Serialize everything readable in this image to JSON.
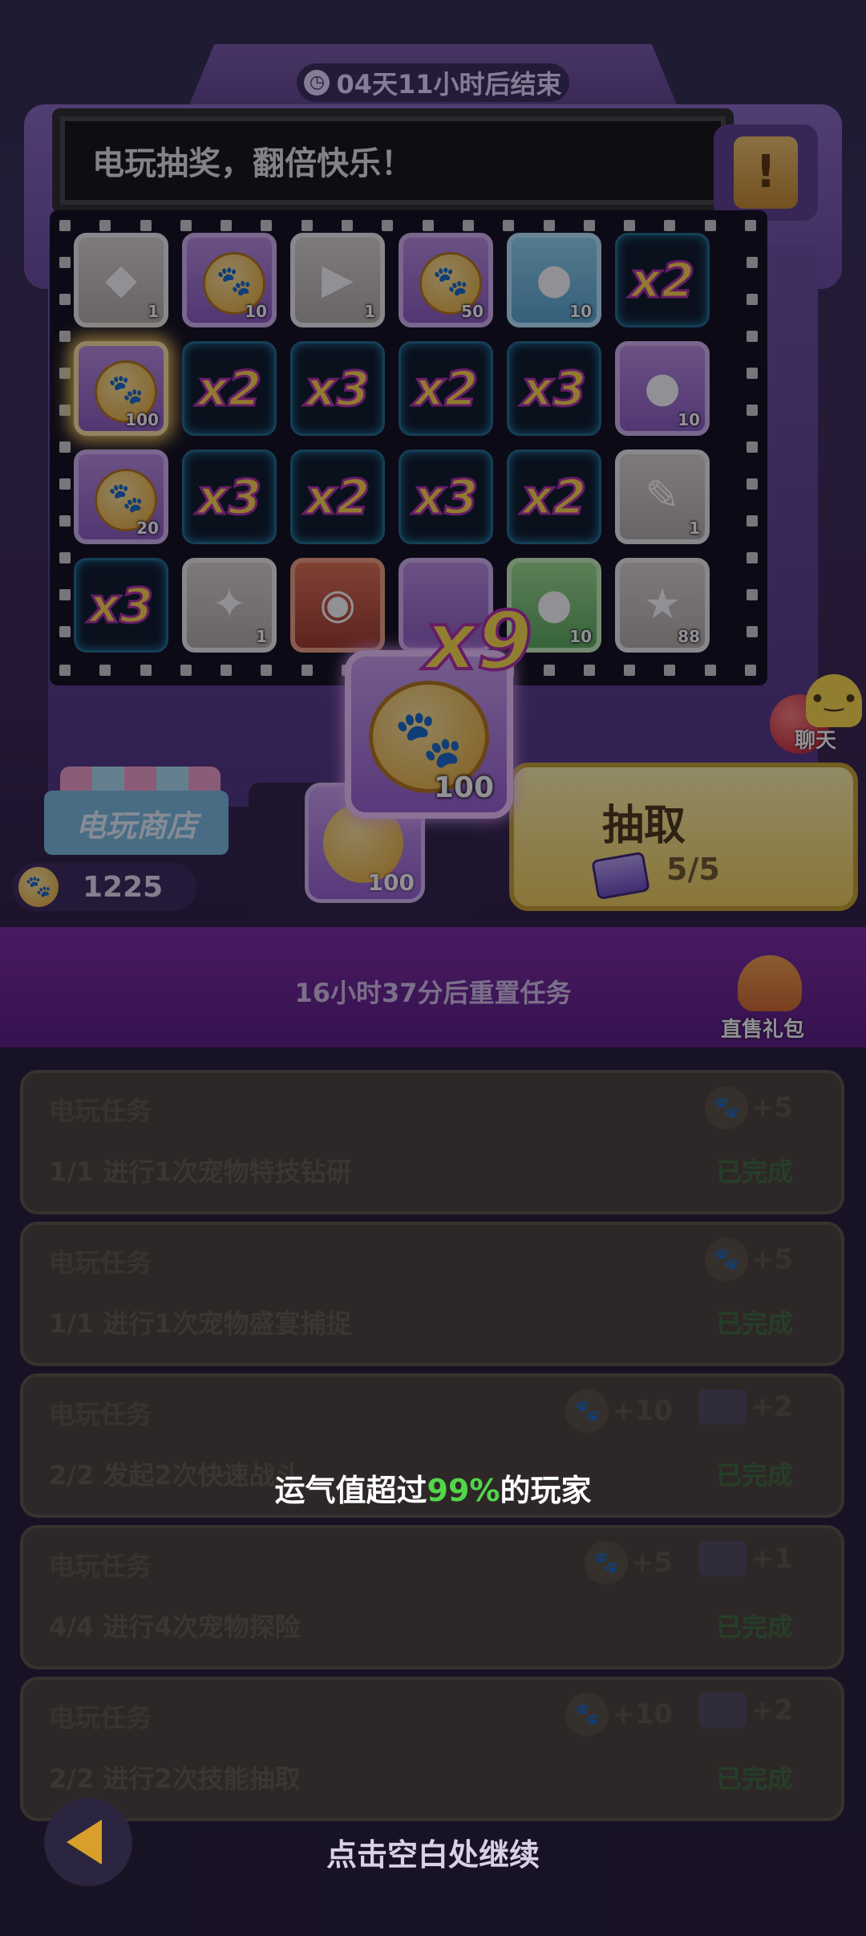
{
  "event": {
    "countdown": "04天11小时后结束",
    "marquee_text": "电玩抽奖，翻倍快乐！",
    "rules_icon": "scroll-exclamation-icon"
  },
  "board": {
    "rows": [
      [
        {
          "kind": "item",
          "tint": "gray",
          "icon": "blue-crystal-icon",
          "count": "1"
        },
        {
          "kind": "item",
          "tint": "purple",
          "icon": "paw-coin-icon",
          "count": "10"
        },
        {
          "kind": "item",
          "tint": "gray",
          "icon": "play-ticket-icon",
          "count": "1"
        },
        {
          "kind": "item",
          "tint": "purple",
          "icon": "paw-coin-icon",
          "count": "50"
        },
        {
          "kind": "item",
          "tint": "blue",
          "icon": "blue-slime-icon",
          "count": "10"
        },
        {
          "kind": "mult",
          "label": "x2"
        }
      ],
      [
        {
          "kind": "item",
          "tint": "purple",
          "icon": "paw-coin-icon",
          "count": "100",
          "lit": true
        },
        {
          "kind": "mult",
          "label": "x2"
        },
        {
          "kind": "mult",
          "label": "x3"
        },
        {
          "kind": "mult",
          "label": "x2"
        },
        {
          "kind": "mult",
          "label": "x3"
        },
        {
          "kind": "item",
          "tint": "purple",
          "icon": "pink-slime-icon",
          "count": "10"
        }
      ],
      [
        {
          "kind": "item",
          "tint": "purple",
          "icon": "paw-coin-icon",
          "count": "20"
        },
        {
          "kind": "mult",
          "label": "x3"
        },
        {
          "kind": "mult",
          "label": "x2"
        },
        {
          "kind": "mult",
          "label": "x3"
        },
        {
          "kind": "mult",
          "label": "x2"
        },
        {
          "kind": "item",
          "tint": "gray",
          "icon": "scroll-quill-icon",
          "count": "1"
        }
      ],
      [
        {
          "kind": "mult",
          "label": "x3"
        },
        {
          "kind": "item",
          "tint": "gray",
          "icon": "green-ticket-icon",
          "count": "1"
        },
        {
          "kind": "item",
          "tint": "red",
          "icon": "coin-bag-icon",
          "count": ""
        },
        {
          "kind": "item",
          "tint": "purple",
          "icon": "hidden-icon",
          "count": ""
        },
        {
          "kind": "item",
          "tint": "green",
          "icon": "green-slime-icon",
          "count": "10"
        },
        {
          "kind": "item",
          "tint": "gray",
          "icon": "starfish-icon",
          "count": "88"
        }
      ]
    ]
  },
  "reward": {
    "multiplier": "x9",
    "count": "100",
    "icon": "paw-coin-icon"
  },
  "shop": {
    "label": "电玩商店",
    "coin_balance": "1225"
  },
  "slot_preview": {
    "count": "100"
  },
  "draw": {
    "label": "抽取",
    "count": "5/5"
  },
  "chat": {
    "label": "聊天"
  },
  "band": {
    "reset_text": "16小时37分后重置任务",
    "gift_label": "直售礼包"
  },
  "tasks": [
    {
      "title": "电玩任务",
      "progress": "1/1",
      "desc": "进行1次宠物特技钻研",
      "rewards": [
        {
          "icon": "paw-coin-icon",
          "amount": "+5"
        }
      ],
      "status": "已完成"
    },
    {
      "title": "电玩任务",
      "progress": "1/1",
      "desc": "进行1次宠物盛宴捕捉",
      "rewards": [
        {
          "icon": "paw-coin-icon",
          "amount": "+5"
        }
      ],
      "status": "已完成"
    },
    {
      "title": "电玩任务",
      "progress": "2/2",
      "desc": "发起2次快速战斗",
      "rewards": [
        {
          "icon": "paw-coin-icon",
          "amount": "+10"
        },
        {
          "icon": "ticket-icon",
          "amount": "+2"
        }
      ],
      "status": "已完成"
    },
    {
      "title": "电玩任务",
      "progress": "4/4",
      "desc": "进行4次宠物探险",
      "rewards": [
        {
          "icon": "paw-coin-icon",
          "amount": "+5"
        },
        {
          "icon": "ticket-icon",
          "amount": "+1"
        }
      ],
      "status": "已完成"
    },
    {
      "title": "电玩任务",
      "progress": "2/2",
      "desc": "进行2次技能抽取",
      "rewards": [
        {
          "icon": "paw-coin-icon",
          "amount": "+10"
        },
        {
          "icon": "ticket-icon",
          "amount": "+2"
        }
      ],
      "status": "已完成"
    }
  ],
  "toast": {
    "prefix": "运气值超过",
    "percent": "99%",
    "suffix": "的玩家"
  },
  "continue_hint": "点击空白处继续",
  "colors": {
    "accent_gold": "#ffd84a",
    "multiplier_stroke": "#b32ea8",
    "toast_green": "#52d64a"
  }
}
